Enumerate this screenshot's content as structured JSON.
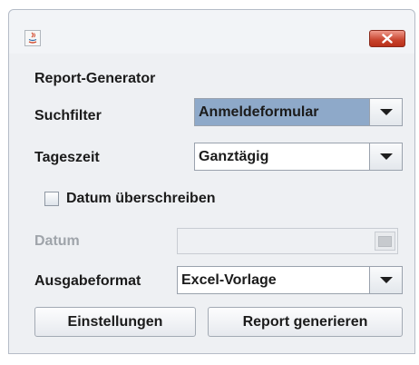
{
  "titlebar": {
    "app_icon": "java-icon",
    "close_icon": "close-icon"
  },
  "form": {
    "heading": "Report-Generator",
    "suchfilter": {
      "label": "Suchfilter",
      "value": "Anmeldeformular"
    },
    "tageszeit": {
      "label": "Tageszeit",
      "value": "Ganztägig"
    },
    "datum_override": {
      "label": "Datum überschreiben",
      "checked": false
    },
    "datum": {
      "label": "Datum",
      "value": "",
      "enabled": false,
      "button_icon": "calendar-icon"
    },
    "ausgabeformat": {
      "label": "Ausgabeformat",
      "value": "Excel-Vorlage"
    }
  },
  "buttons": {
    "settings": "Einstellungen",
    "generate": "Report generieren"
  },
  "colors": {
    "selected_combo": "#8ea9c9",
    "close_button": "#c8432d"
  }
}
